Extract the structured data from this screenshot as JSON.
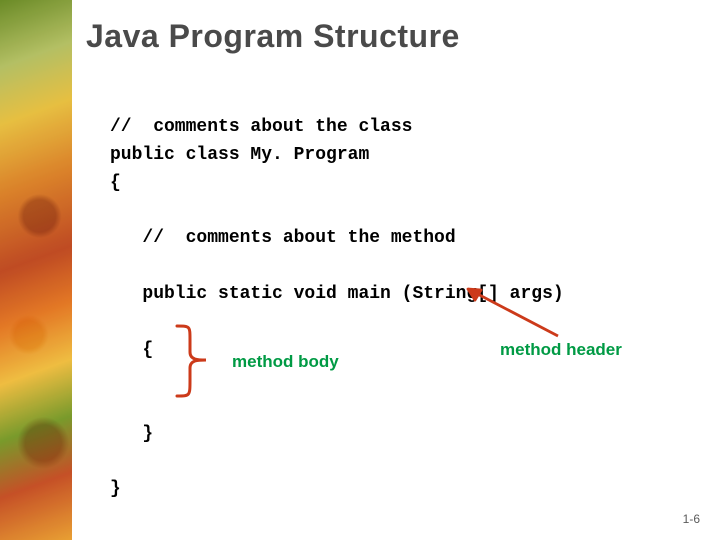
{
  "title": "Java Program Structure",
  "code": {
    "l1": "//  comments about the class",
    "l2": "public class My. Program",
    "l3": "{",
    "l4": "   //  comments about the method",
    "l5": "   public static void main (String[] args)",
    "l6": "   {",
    "l7": "   }",
    "l8": "}"
  },
  "labels": {
    "method_body": "method body",
    "method_header": "method header"
  },
  "page_number": "1-6"
}
